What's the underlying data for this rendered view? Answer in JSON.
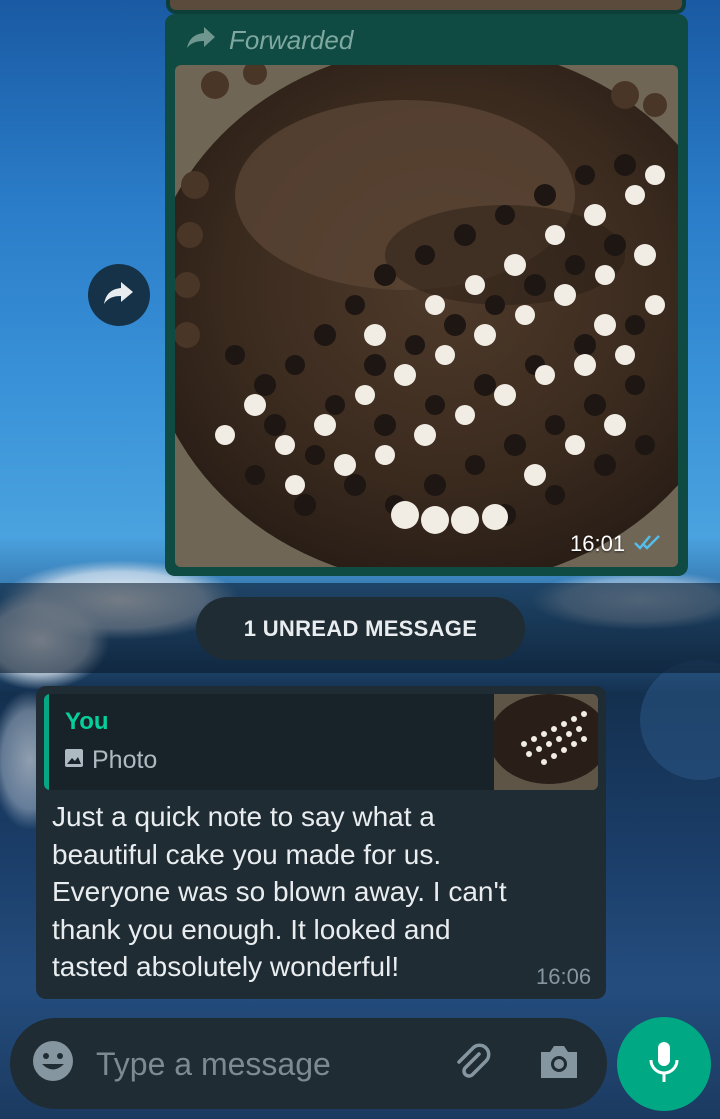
{
  "forwarded_message": {
    "label": "Forwarded",
    "time": "16:01",
    "status": "read",
    "photo_alt": "Chocolate cake with chocolate chips"
  },
  "unread_divider": {
    "label": "1 UNREAD MESSAGE"
  },
  "reply_message": {
    "quote_author": "You",
    "quote_type": "Photo",
    "text": "Just a quick note to say what a beautiful cake you made for us. Everyone was so blown away. I can't thank you enough. It looked and tasted absolutely wonderful!",
    "time": "16:06"
  },
  "composer": {
    "placeholder": "Type a message"
  },
  "icons": {
    "forward": "forward-arrow-icon",
    "share": "share-icon",
    "read_ticks": "double-check-icon",
    "photo": "photo-icon",
    "emoji": "emoji-icon",
    "attach": "paperclip-icon",
    "camera": "camera-icon",
    "mic": "mic-icon"
  },
  "colors": {
    "accent": "#00a884",
    "bubble_outgoing": "#0f4b43",
    "bubble_incoming": "#1f2c34",
    "quote_author": "#06cf9c",
    "read_ticks": "#53bdeb"
  }
}
